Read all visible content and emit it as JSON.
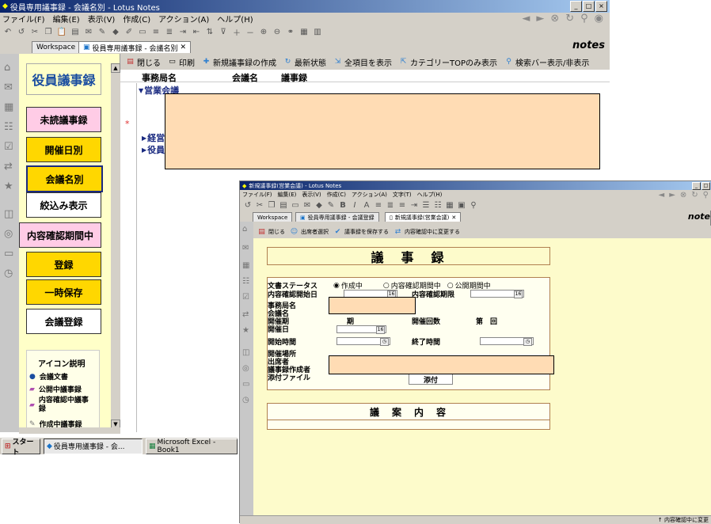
{
  "main": {
    "title": "役員専用議事録 - 会議名別 - Lotus Notes",
    "menu": [
      "ファイル(F)",
      "編集(E)",
      "表示(V)",
      "作成(C)",
      "アクション(A)",
      "ヘルプ(H)"
    ],
    "tabs": {
      "workspace": "Workspace",
      "db": "役員専用議事録 - 会議名別"
    },
    "brand": "notes",
    "actions": [
      "閉じる",
      "印刷",
      "新規議事録の作成",
      "最新状態",
      "全項目を表示",
      "カテゴリーTOPのみ表示",
      "検索バー表示/非表示"
    ],
    "columns": [
      "事務局名",
      "会議名",
      "議事録"
    ],
    "rows": [
      "営業会議",
      "経営",
      "役員"
    ]
  },
  "nav": {
    "title": "役員議事録",
    "buttons": [
      "未読議事録",
      "開催日別",
      "会議名別",
      "絞込み表示",
      "内容確認期間中",
      "登録",
      "一時保存",
      "会議登録"
    ],
    "legend_title": "アイコン説明",
    "legend": [
      "会議文書",
      "公開中議事録",
      "内容確認中議事録",
      "作成中議事録"
    ]
  },
  "taskbar": {
    "start": "スタート",
    "items": [
      "役員専用議事録 - 会...",
      "Microsoft Excel - Book1"
    ]
  },
  "form": {
    "title": "新規議事録(営業会議) - Lotus Notes",
    "menu": [
      "ファイル(F)",
      "編集(E)",
      "表示(V)",
      "作成(C)",
      "アクション(A)",
      "文字(T)",
      "ヘルプ(H)"
    ],
    "tabs": {
      "workspace": "Workspace",
      "db": "役員専用議事録 - 会議登録",
      "doc": "新規議事録(営業会議)"
    },
    "brand": "note",
    "actions": [
      "閉じる",
      "出席者選択",
      "議事録を保存する",
      "内容確認中に変更する"
    ],
    "heading": "議　事　録",
    "status_label": "文書ステータス",
    "status_options": [
      "作成中",
      "内容確認期間中",
      "公開期間中"
    ],
    "fields": {
      "confirm_start": "内容確認開始日",
      "confirm_end": "内容確認期限",
      "office": "事務局名",
      "meeting": "会議名",
      "term": "開催期",
      "term_value": "期",
      "count": "開催回数",
      "count_value": "第　回",
      "date": "開催日",
      "start_time": "開始時間",
      "end_time": "終了時間",
      "place": "開催場所",
      "attendees": "出席者",
      "author": "議事録作成者",
      "attachment": "添付ファイル",
      "attach_btn": "添付"
    },
    "agenda_heading": "議　案　内　容",
    "status_bar": "↑ 内容確認中に変更"
  },
  "colors": {
    "peach": "#ffdcb4",
    "nav_bg": "#ffffc8",
    "yellow_btn": "#ffd700",
    "pale_yellow": "#ffff99",
    "form_bg": "#fdfbcb"
  }
}
